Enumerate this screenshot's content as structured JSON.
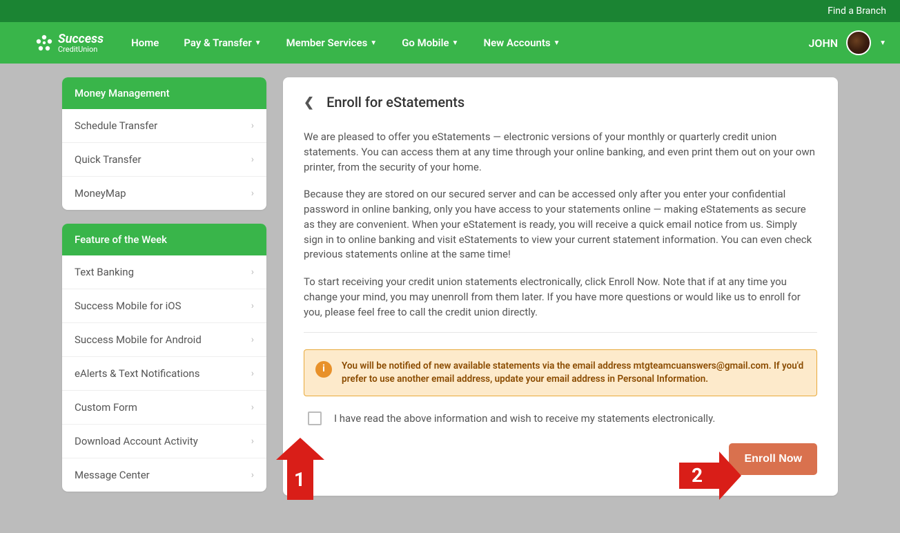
{
  "topbar": {
    "find_branch": "Find a Branch"
  },
  "logo": {
    "top": "Success",
    "bottom": "CreditUnion"
  },
  "nav": {
    "home": "Home",
    "pay": "Pay & Transfer",
    "member": "Member Services",
    "mobile": "Go Mobile",
    "new": "New Accounts"
  },
  "user": {
    "name": "JOHN"
  },
  "sidebar": {
    "group1": {
      "title": "Money Management",
      "items": [
        "Schedule Transfer",
        "Quick Transfer",
        "MoneyMap"
      ]
    },
    "group2": {
      "title": "Feature of the Week",
      "items": [
        "Text Banking",
        "Success Mobile for iOS",
        "Success Mobile for Android",
        "eAlerts & Text Notifications",
        "Custom Form",
        "Download Account Activity",
        "Message Center"
      ]
    }
  },
  "main": {
    "title": "Enroll for eStatements",
    "p1": "We are pleased to offer you eStatements — electronic versions of your monthly or quarterly credit union statements. You can access them at any time through your online banking, and even print them out on your own printer, from the security of your home.",
    "p2": "Because they are stored on our secured server and can be accessed only after you enter your confidential password in online banking, only you have access to your statements online — making eStatements as secure as they are convenient. When your eStatement is ready, you will receive a quick email notice from us. Simply sign in to online banking and visit eStatements to view your current statement information. You can even check previous statements online at the same time!",
    "p3": "To start receiving your credit union statements electronically, click Enroll Now. Note that if at any time you change your mind, you may unenroll from them later. If you have more questions or would like us to enroll for you, please feel free to call the credit union directly.",
    "info": "You will be notified of new available statements via the email address mtgteamcuanswers@gmail.com. If you'd prefer to use another email address, update your email address in Personal Information.",
    "consent": "I have read the above information and wish to receive my statements electronically.",
    "enroll": "Enroll Now"
  },
  "callouts": {
    "one": "1",
    "two": "2"
  }
}
